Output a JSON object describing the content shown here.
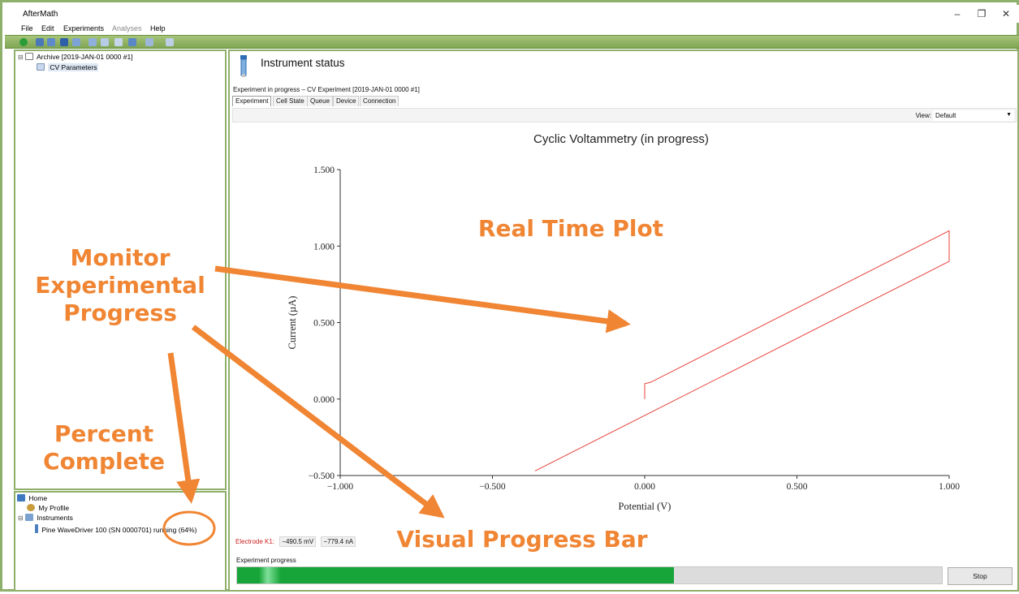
{
  "app": {
    "title": "AfterMath"
  },
  "window_controls": {
    "minimize": "–",
    "restore": "❐",
    "close": "✕"
  },
  "menu": [
    {
      "label": "File",
      "enabled": true
    },
    {
      "label": "Edit",
      "enabled": true
    },
    {
      "label": "Experiments",
      "enabled": true
    },
    {
      "label": "Analyses",
      "enabled": false
    },
    {
      "label": "Help",
      "enabled": true
    }
  ],
  "archive_tree": {
    "archive_label": "Archive [2019-JAN-01 0000 #1]",
    "child_label": "CV Parameters"
  },
  "home_tree": {
    "home_label": "Home",
    "profile_label": "My Profile",
    "instruments_label": "Instruments",
    "instrument_status": "Pine WaveDriver 100 (SN 0000701) running (64%)"
  },
  "instrument": {
    "title": "Instrument status",
    "experiment_line": "Experiment in progress – CV Experiment [2019-JAN-01 0000 #1]",
    "tabs": [
      "Experiment",
      "Cell State",
      "Queue",
      "Device",
      "Connection"
    ],
    "active_tab": 0,
    "view_label": "View:",
    "view_value": "Default"
  },
  "chart_data": {
    "type": "line",
    "title": "Cyclic Voltammetry (in progress)",
    "xlabel": "Potential (V)",
    "ylabel": "Current (µA)",
    "xlim": [
      -1.0,
      1.0
    ],
    "ylim": [
      -0.5,
      1.5
    ],
    "xticks": [
      "−1.000",
      "−0.500",
      "0.000",
      "0.500",
      "1.000"
    ],
    "xtick_values": [
      -1.0,
      -0.5,
      0.0,
      0.5,
      1.0
    ],
    "yticks": [
      "−0.500",
      "0.000",
      "0.500",
      "1.000",
      "1.500"
    ],
    "ytick_values": [
      -0.5,
      0.0,
      0.5,
      1.0,
      1.5
    ],
    "grid": false,
    "color": "#e8423a",
    "series": [
      {
        "x": [
          0.0,
          0.0,
          0.02,
          1.0,
          1.0,
          -0.36
        ],
        "y": [
          0.0,
          0.1,
          0.11,
          1.1,
          0.9,
          -0.47
        ]
      }
    ]
  },
  "electrode": {
    "label": "Electrode K1:",
    "potential": "−490.5 mV",
    "current": "−779.4 nA"
  },
  "progress": {
    "label": "Experiment progress",
    "fraction": 0.62,
    "stop_label": "Stop"
  },
  "annotations": {
    "monitor": [
      "Monitor",
      "Experimental",
      "Progress"
    ],
    "percent": [
      "Percent",
      "Complete"
    ],
    "real_time": "Real Time Plot",
    "progress_bar": "Visual Progress Bar",
    "color": "#f08533"
  }
}
